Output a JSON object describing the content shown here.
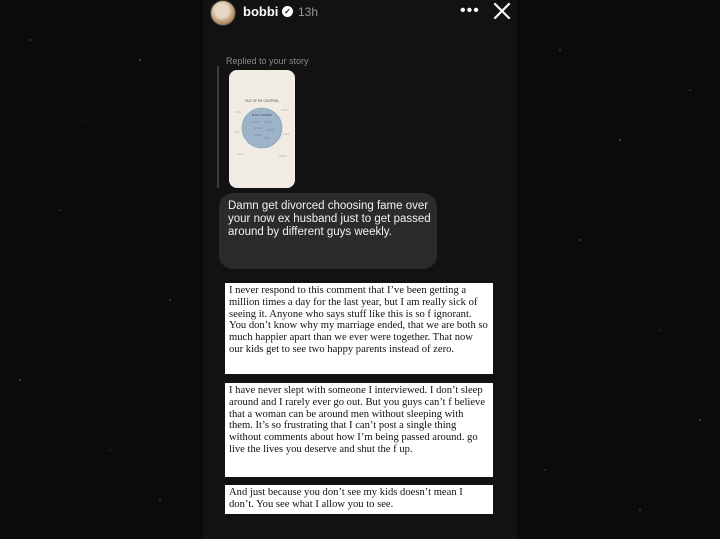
{
  "header": {
    "username": "bobbi",
    "time": "13h",
    "more_icon": "more-dots-icon",
    "close_icon": "close-icon",
    "verified_icon": "verified-badge-icon"
  },
  "reply": {
    "label": "Replied to your story",
    "thumbnail_title": "OUT OF MY CONTROL",
    "thumbnail_circle": "IN MY CONTROL"
  },
  "message": {
    "text": "Damn get divorced choosing fame over your now ex husband just to get passed around by different guys weekly."
  },
  "notes": [
    {
      "text": "I never respond to this comment that I’ve been getting a million times a day for the last year, but I am really sick of seeing it. Anyone who says stuff like this is so f ignorant. You don’t know why my marriage ended, that we are both so much happier apart than we ever were together. That now our kids get to see two happy parents instead of zero."
    },
    {
      "text": "I have never slept with someone I interviewed. I don’t sleep around and I rarely ever go out. But you guys can’t f believe that a woman can be around men without sleeping with them. It’s so frustrating that I can’t post a single thing without comments about how I’m being passed around. go live the lives you deserve and shut the f up."
    },
    {
      "text": "And just because you don’t see my kids doesn’t mean I don’t. You see what I allow you to see."
    }
  ]
}
